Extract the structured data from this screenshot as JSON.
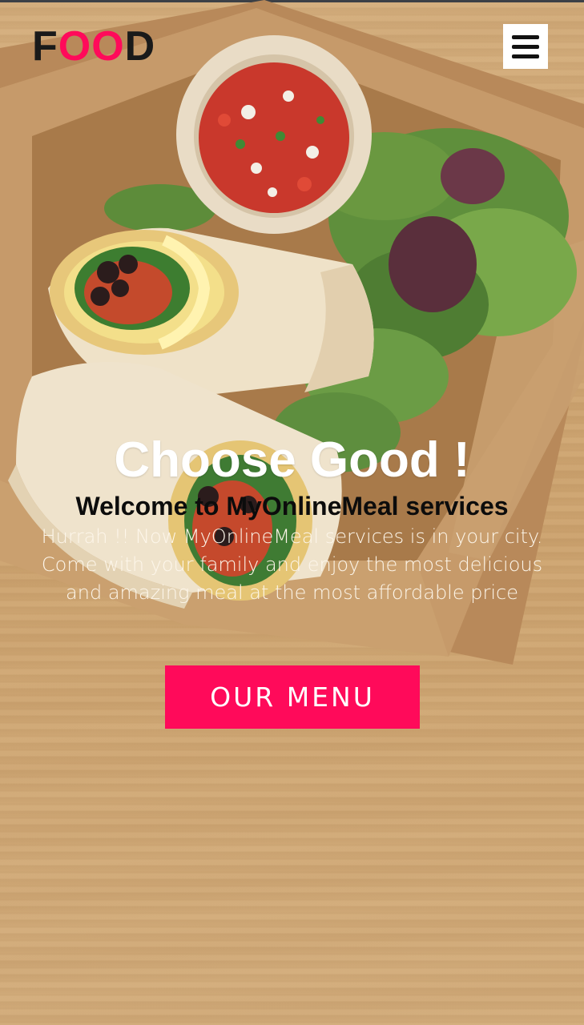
{
  "header": {
    "logo_letters": [
      "F",
      "O",
      "O",
      "D"
    ],
    "logo_colors": [
      "#1a1a1a",
      "#ff0a5a",
      "#ff0a5a",
      "#1a1a1a"
    ],
    "menu_icon": "hamburger-menu-icon"
  },
  "hero": {
    "title": "Choose Good !",
    "subtitle": "Welcome to MyOnlineMeal services",
    "description": "Hurrah !! Now MyOnlineMeal services is in your city. Come with your family and enjoy the most delicious and amazing meal at the most affordable price",
    "cta_label": "OUR MENU"
  },
  "colors": {
    "accent": "#ff0a5a",
    "text_dark": "#1a1a1a",
    "background_wood": "#cfa876"
  }
}
